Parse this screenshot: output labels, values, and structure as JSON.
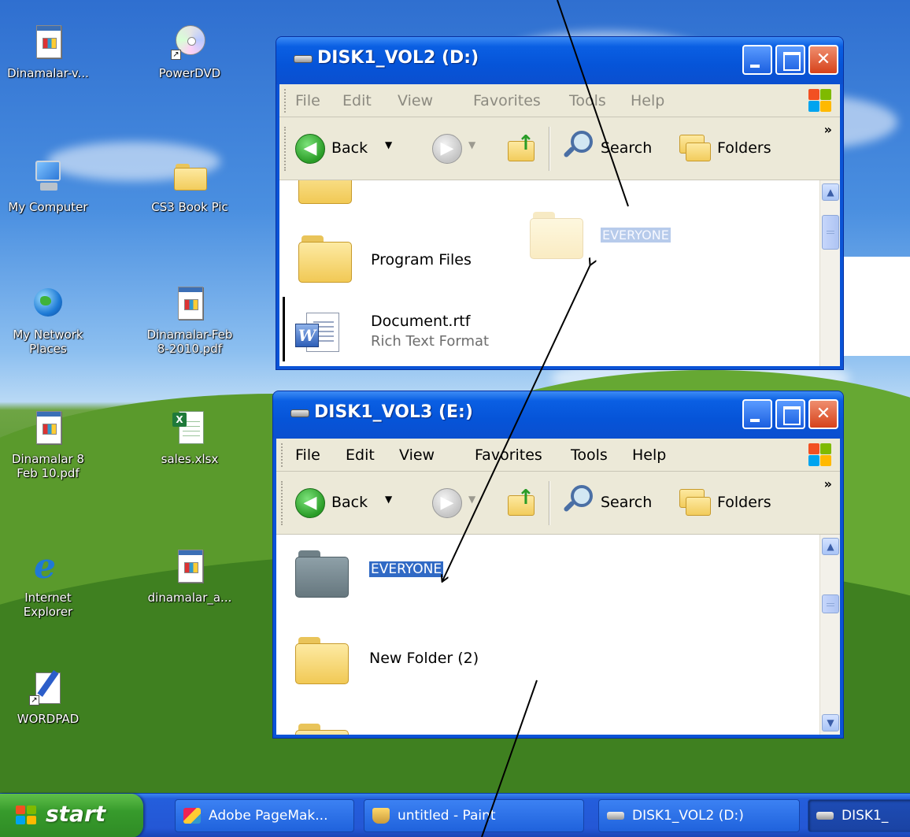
{
  "desktop": {
    "icons": [
      {
        "label": "Dinamalar-v...",
        "icon": "pdf-document-icon"
      },
      {
        "label": "PowerDVD",
        "icon": "dvd-disc-icon"
      },
      {
        "label": "My Computer",
        "icon": "computer-icon"
      },
      {
        "label": "CS3 Book Pic",
        "icon": "folder-icon"
      },
      {
        "label": "My Network\nPlaces",
        "icon": "network-globe-icon"
      },
      {
        "label": "Dinamalar-Feb\n8-2010.pdf",
        "icon": "pdf-document-icon"
      },
      {
        "label": "Dinamalar 8\nFeb 10.pdf",
        "icon": "pdf-document-icon"
      },
      {
        "label": "sales.xlsx",
        "icon": "excel-icon"
      },
      {
        "label": "Internet\nExplorer",
        "icon": "internet-explorer-icon"
      },
      {
        "label": "dinamalar_a...",
        "icon": "pdf-document-icon"
      },
      {
        "label": "WORDPAD",
        "icon": "wordpad-icon"
      }
    ]
  },
  "window_top": {
    "title": "DISK1_VOL2 (D:)",
    "menu": [
      "File",
      "Edit",
      "View",
      "Favorites",
      "Tools",
      "Help"
    ],
    "toolbar": {
      "back": "Back",
      "search": "Search",
      "folders": "Folders",
      "more": "»"
    },
    "items": {
      "program_files": "Program Files",
      "everyone_ghost": "EVERYONE",
      "document_name": "Document.rtf",
      "document_type": "Rich Text Format"
    }
  },
  "window_bottom": {
    "title": "DISK1_VOL3 (E:)",
    "menu": [
      "File",
      "Edit",
      "View",
      "Favorites",
      "Tools",
      "Help"
    ],
    "toolbar": {
      "back": "Back",
      "search": "Search",
      "folders": "Folders",
      "more": "»"
    },
    "items": {
      "everyone": "EVERYONE",
      "new_folder": "New Folder (2)"
    }
  },
  "taskbar": {
    "start": "start",
    "tasks": [
      {
        "label": "Adobe PageMak...",
        "icon": "pagemaker-icon"
      },
      {
        "label": "untitled - Paint",
        "icon": "paint-icon"
      },
      {
        "label": "DISK1_VOL2 (D:)",
        "icon": "drive-icon"
      },
      {
        "label": "DISK1_",
        "icon": "drive-icon"
      }
    ]
  },
  "colors": {
    "title_bar": "#0a5fe3",
    "selection": "#316ac5",
    "start_button": "#379b2c",
    "close_button": "#d6421b"
  }
}
